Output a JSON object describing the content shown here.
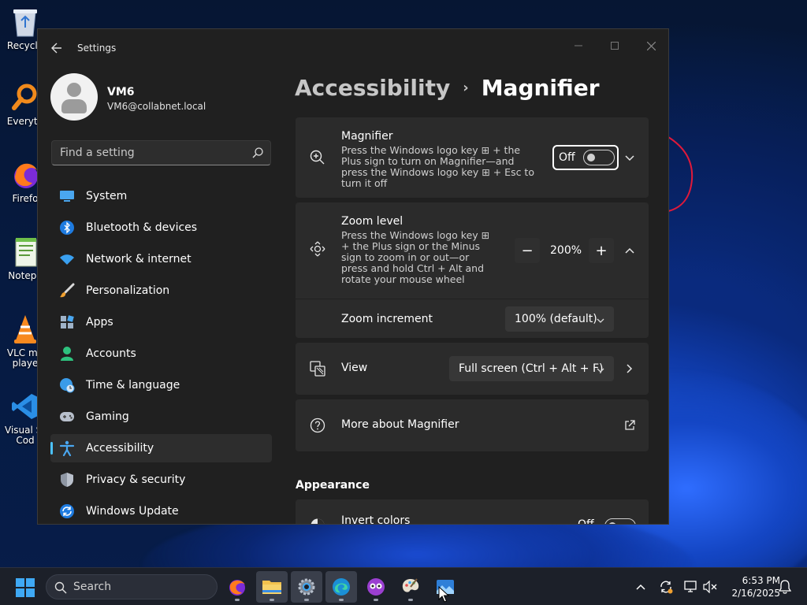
{
  "desktop": {
    "icons": [
      {
        "label": "Recycle",
        "icon": "recycle-bin-icon"
      },
      {
        "label": "Everyth",
        "icon": "everything-search-icon"
      },
      {
        "label": "Firefo",
        "icon": "firefox-icon"
      },
      {
        "label": "Notepa",
        "icon": "notepad-icon"
      },
      {
        "label": "VLC me\nplaye",
        "icon": "vlc-icon"
      },
      {
        "label": "Visual St\nCod",
        "icon": "vscode-icon"
      }
    ]
  },
  "window": {
    "app_title": "Settings"
  },
  "profile": {
    "name": "VM6",
    "email": "VM6@collabnet.local"
  },
  "search": {
    "placeholder": "Find a setting"
  },
  "nav": [
    {
      "label": "System",
      "icon": "system-display-icon",
      "active": false
    },
    {
      "label": "Bluetooth & devices",
      "icon": "bluetooth-icon",
      "active": false
    },
    {
      "label": "Network & internet",
      "icon": "wifi-icon",
      "active": false
    },
    {
      "label": "Personalization",
      "icon": "paintbrush-icon",
      "active": false
    },
    {
      "label": "Apps",
      "icon": "apps-icon",
      "active": false
    },
    {
      "label": "Accounts",
      "icon": "account-icon",
      "active": false
    },
    {
      "label": "Time & language",
      "icon": "globe-clock-icon",
      "active": false
    },
    {
      "label": "Gaming",
      "icon": "gamepad-icon",
      "active": false
    },
    {
      "label": "Accessibility",
      "icon": "accessibility-icon",
      "active": true
    },
    {
      "label": "Privacy & security",
      "icon": "shield-icon",
      "active": false
    },
    {
      "label": "Windows Update",
      "icon": "windows-update-icon",
      "active": false
    }
  ],
  "breadcrumb": {
    "parent": "Accessibility",
    "separator": "›",
    "current": "Magnifier"
  },
  "magnifier": {
    "title": "Magnifier",
    "desc": [
      "Press the Windows logo key ⊞ + the",
      "Plus sign to turn on Magnifier—and",
      "press the Windows logo key ⊞ + Esc to",
      "turn it off"
    ],
    "toggle_label": "Off",
    "toggle_on": false
  },
  "zoom_level": {
    "title": "Zoom level",
    "desc": [
      "Press the Windows logo key ⊞",
      "+ the Plus sign or the Minus",
      "sign to zoom in or out—or",
      "press and hold Ctrl + Alt and",
      "rotate your mouse wheel"
    ],
    "minus": "−",
    "value": "200%",
    "plus": "+"
  },
  "zoom_increment": {
    "label": "Zoom increment",
    "selected": "100% (default)"
  },
  "view": {
    "label": "View",
    "selected": "Full screen (Ctrl + Alt + F)"
  },
  "more": {
    "label": "More about Magnifier"
  },
  "appearance": {
    "heading": "Appearance",
    "invert_label": "Invert colors",
    "invert_toggle": "Off"
  },
  "taskbar": {
    "search_label": "Search",
    "apps": [
      {
        "name": "firefox-icon",
        "running": false
      },
      {
        "name": "file-explorer-icon",
        "running": true
      },
      {
        "name": "settings-gear-icon",
        "running": true
      },
      {
        "name": "edge-icon",
        "running": true
      },
      {
        "name": "owl-app-icon",
        "running": false
      },
      {
        "name": "paint-palette-icon",
        "running": false
      },
      {
        "name": "photos-icon",
        "running": false
      }
    ],
    "time": "6:53 PM",
    "date": "2/16/2025"
  },
  "colors": {
    "accent": "#4cc2ff",
    "window_bg": "#202020",
    "card_bg": "#2b2b2b"
  }
}
